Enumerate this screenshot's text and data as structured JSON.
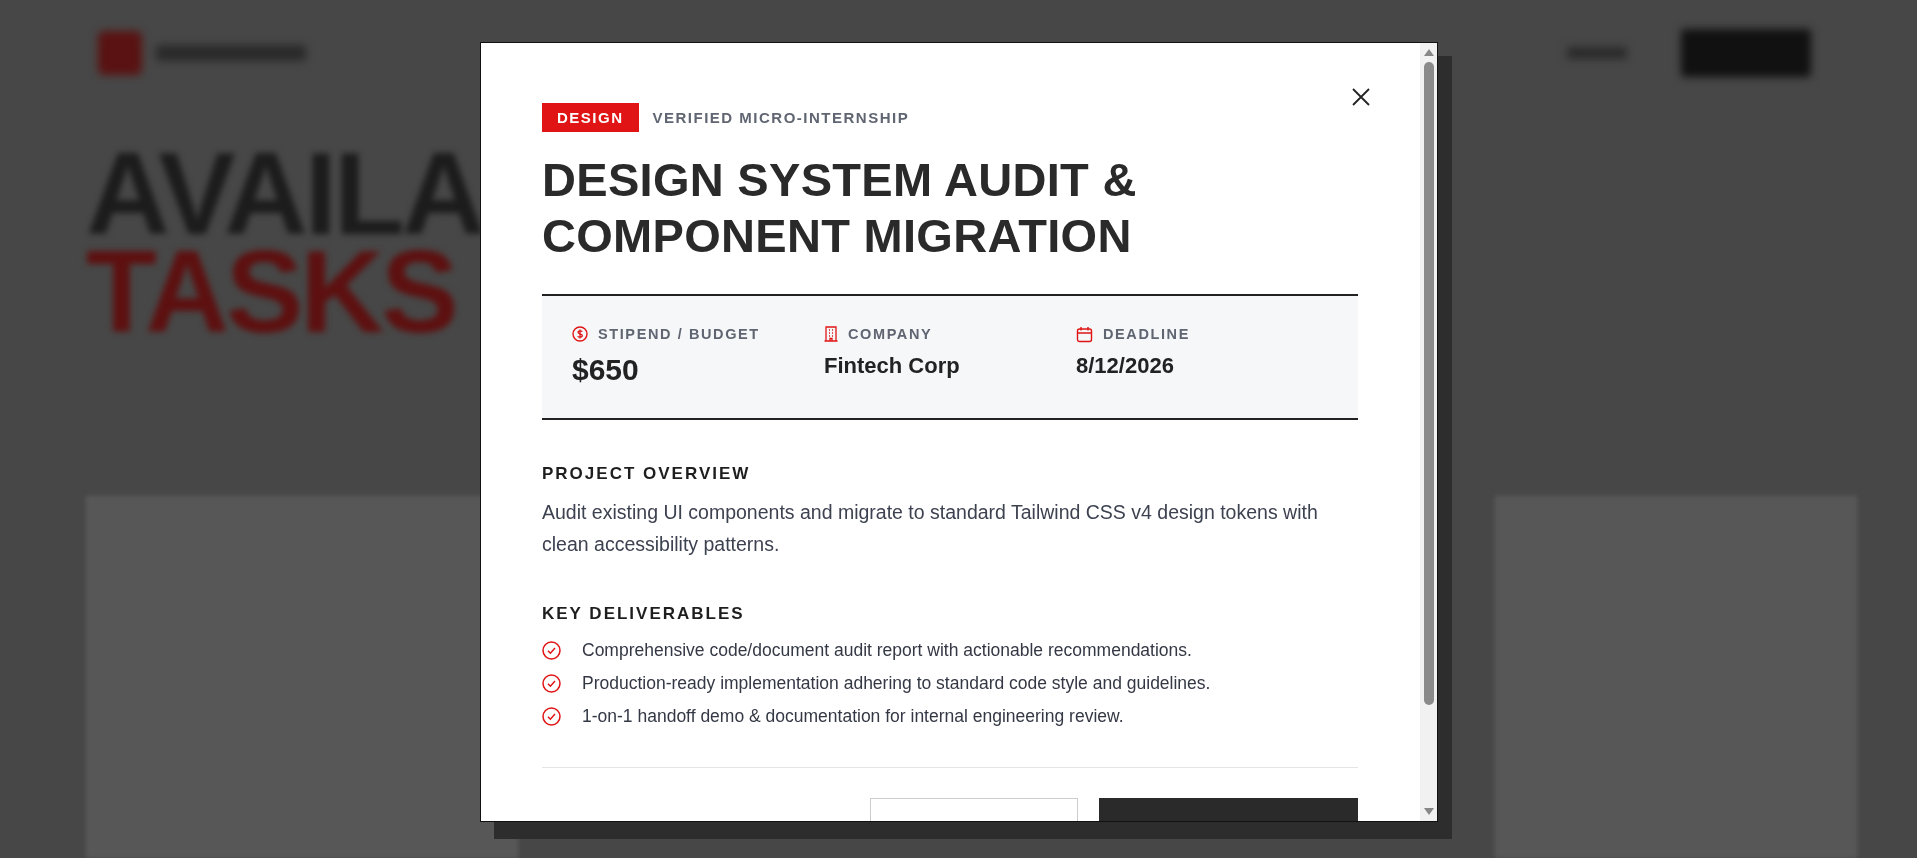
{
  "background": {
    "heading_line_1": "AVAILA",
    "heading_line_2": "TASKS"
  },
  "modal": {
    "category": "DESIGN",
    "label": "VERIFIED MICRO-INTERNSHIP",
    "title": "DESIGN SYSTEM AUDIT & COMPONENT MIGRATION",
    "stats": [
      {
        "kind": "money",
        "label": "STIPEND / BUDGET",
        "value": "$650"
      },
      {
        "kind": "company",
        "label": "COMPANY",
        "value": "Fintech Corp"
      },
      {
        "kind": "date",
        "label": "DEADLINE",
        "value": "8/12/2026"
      }
    ],
    "overview_heading": "PROJECT OVERVIEW",
    "overview": "Audit existing UI components and migrate to standard Tailwind CSS v4 design tokens with clean accessibility patterns.",
    "deliverables_heading": "KEY DELIVERABLES",
    "deliverables": [
      "Comprehensive code/document audit report with actionable recommendations.",
      "Production-ready implementation adhering to standard code style and guidelines.",
      "1-on-1 handoff demo & documentation for internal engineering review."
    ]
  }
}
